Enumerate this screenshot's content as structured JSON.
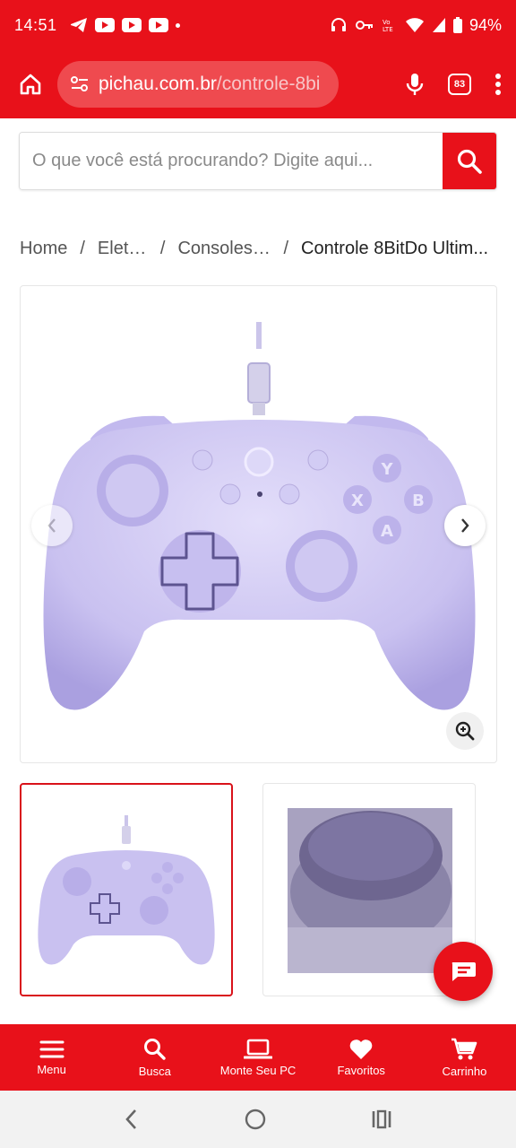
{
  "status_bar": {
    "time": "14:51",
    "battery": "94%"
  },
  "browser": {
    "url_domain": "pichau.com.br",
    "url_path": "/controle-8bi",
    "tab_count": "83"
  },
  "search": {
    "placeholder": "O que você está procurando? Digite aqui..."
  },
  "breadcrumb": {
    "items": [
      "Home",
      "Eletr...",
      "Consoles ...",
      "Controle 8BitDo Ultim..."
    ],
    "separator": "/"
  },
  "product": {
    "controller_color": "#c9c1f0",
    "face_buttons": [
      "Y",
      "X",
      "B",
      "A"
    ]
  },
  "bottom_nav": {
    "items": [
      {
        "label": "Menu",
        "icon": "menu-icon"
      },
      {
        "label": "Busca",
        "icon": "search-icon"
      },
      {
        "label": "Monte Seu PC",
        "icon": "laptop-icon"
      },
      {
        "label": "Favoritos",
        "icon": "heart-icon"
      },
      {
        "label": "Carrinho",
        "icon": "cart-icon"
      }
    ]
  },
  "colors": {
    "brand": "#e8111a"
  }
}
